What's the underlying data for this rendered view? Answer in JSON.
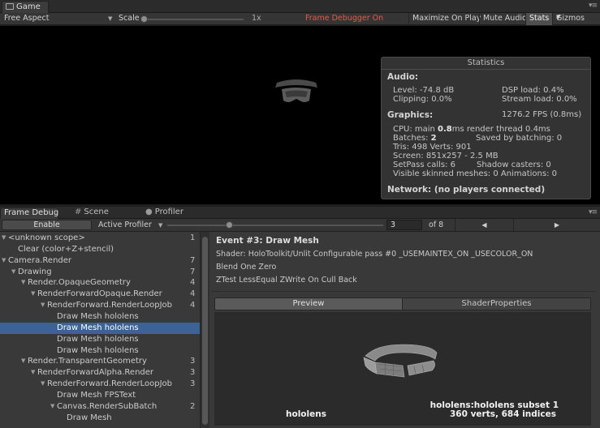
{
  "game": {
    "tab_label": "Game",
    "aspect": "Free Aspect",
    "scale_label": "Scale",
    "scale_value": "1x",
    "scale_level": 0,
    "frame_debugger_status": "Frame Debugger On",
    "buttons": {
      "maximize": "Maximize On Play",
      "mute": "Mute Audio",
      "stats": "Stats",
      "gizmos": "Gizmos"
    }
  },
  "stats": {
    "title": "Statistics",
    "audio_header": "Audio:",
    "level": "Level: -74.8 dB",
    "clipping": "Clipping: 0.0%",
    "dsp": "DSP load: 0.4%",
    "stream": "Stream load: 0.0%",
    "graphics_header": "Graphics:",
    "fps": "1276.2 FPS (0.8ms)",
    "cpu_prefix": "CPU: main ",
    "cpu_main": "0.8",
    "cpu_suffix": "ms  render thread 0.4ms",
    "batches_prefix": "Batches: ",
    "batches": "2",
    "saved_batching": "Saved by batching: 0",
    "tris": "Tris: 498  Verts: 901",
    "screen": "Screen: 851x257 - 2.5 MB",
    "setpass": "SetPass calls: 6",
    "shadow": "Shadow casters: 0",
    "skinned": "Visible skinned meshes: 0  Animations: 0",
    "network": "Network: (no players connected)"
  },
  "lower_tabs": {
    "frame_debug": "Frame Debug",
    "scene": "Scene",
    "profiler": "Profiler"
  },
  "frame_debug": {
    "enable_label": "Enable",
    "active_profiler": "Active Profiler",
    "current_event": "3",
    "event_count": "of 8",
    "event_position": 0.29,
    "prev_glyph": "◀",
    "next_glyph": "▶"
  },
  "tree": [
    {
      "text": "<unknown scope>",
      "count": "1",
      "indent": 0,
      "fold": true,
      "selected": false
    },
    {
      "text": "Clear (color+Z+stencil)",
      "count": "",
      "indent": 1,
      "fold": false,
      "selected": false
    },
    {
      "text": "Camera.Render",
      "count": "7",
      "indent": 0,
      "fold": true,
      "selected": false
    },
    {
      "text": "Drawing",
      "count": "7",
      "indent": 1,
      "fold": true,
      "selected": false
    },
    {
      "text": "Render.OpaqueGeometry",
      "count": "4",
      "indent": 2,
      "fold": true,
      "selected": false
    },
    {
      "text": "RenderForwardOpaque.Render",
      "count": "4",
      "indent": 3,
      "fold": true,
      "selected": false
    },
    {
      "text": "RenderForward.RenderLoopJob",
      "count": "4",
      "indent": 4,
      "fold": true,
      "selected": false
    },
    {
      "text": "Draw Mesh hololens",
      "count": "",
      "indent": 5,
      "fold": false,
      "selected": false
    },
    {
      "text": "Draw Mesh hololens",
      "count": "",
      "indent": 5,
      "fold": false,
      "selected": true
    },
    {
      "text": "Draw Mesh hololens",
      "count": "",
      "indent": 5,
      "fold": false,
      "selected": false
    },
    {
      "text": "Draw Mesh hololens",
      "count": "",
      "indent": 5,
      "fold": false,
      "selected": false
    },
    {
      "text": "Render.TransparentGeometry",
      "count": "3",
      "indent": 2,
      "fold": true,
      "selected": false
    },
    {
      "text": "RenderForwardAlpha.Render",
      "count": "3",
      "indent": 3,
      "fold": true,
      "selected": false
    },
    {
      "text": "RenderForward.RenderLoopJob",
      "count": "3",
      "indent": 4,
      "fold": true,
      "selected": false
    },
    {
      "text": "Draw Mesh FPSText",
      "count": "",
      "indent": 5,
      "fold": false,
      "selected": false
    },
    {
      "text": "Canvas.RenderSubBatch",
      "count": "2",
      "indent": 5,
      "fold": true,
      "selected": false
    },
    {
      "text": "Draw Mesh",
      "count": "",
      "indent": 6,
      "fold": false,
      "selected": false
    }
  ],
  "details": {
    "event_title": "Event #3: Draw Mesh",
    "shader": "Shader: HoloToolkit/Unlit Configurable pass #0  _USEMAINTEX_ON _USECOLOR_ON",
    "blend": "Blend One Zero",
    "ztest": "ZTest LessEqual ZWrite On Cull Back",
    "preview_tab": "Preview",
    "shader_properties_tab": "ShaderProperties",
    "mesh_name": "hololens",
    "subset_name": "hololens:hololens subset 1",
    "mesh_stats": "360 verts, 684 indices"
  },
  "colors": {
    "selection": "#3d6296",
    "frame_debugger_on": "#e25a4a",
    "panel": "#393939",
    "game_background": "#000000"
  },
  "icons": [
    "game-icon",
    "scene-grid-icon",
    "profiler-icon",
    "window-menu-icon",
    "dropdown-arrow-icon",
    "fold-arrow-icon"
  ]
}
